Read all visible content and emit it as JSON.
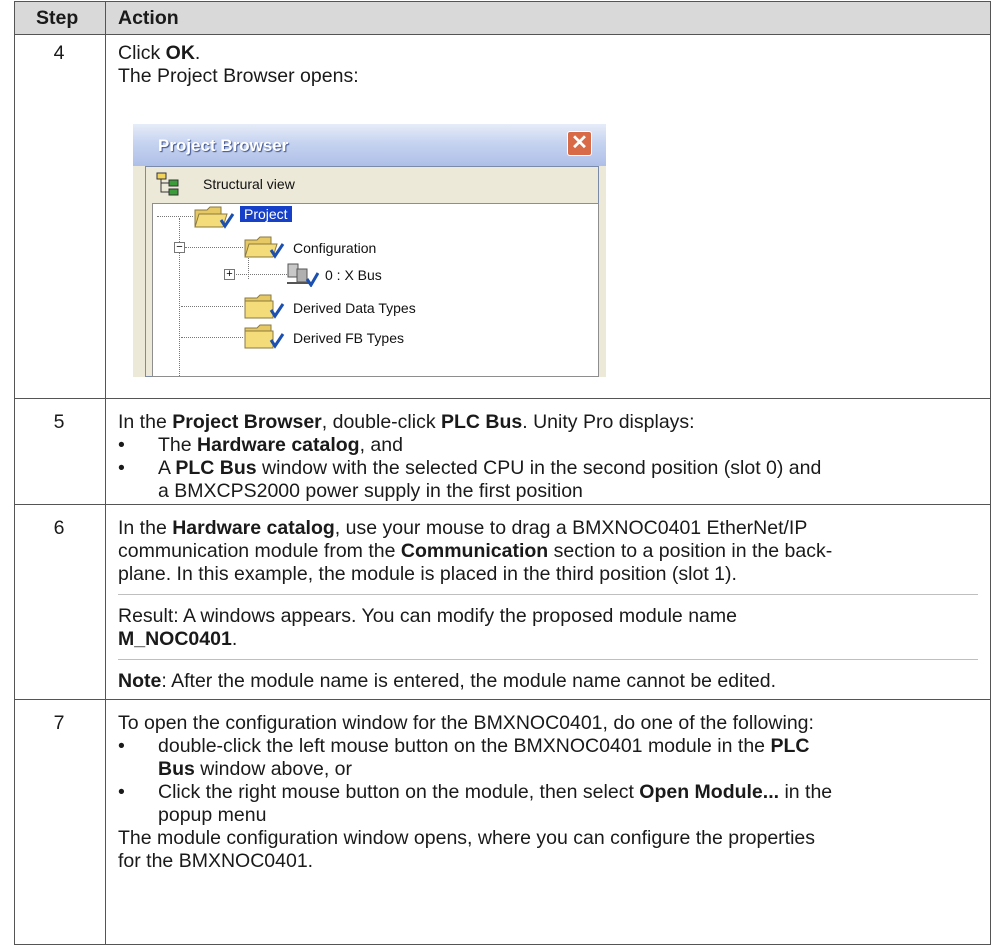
{
  "header": {
    "step": "Step",
    "action": "Action"
  },
  "rows": [
    {
      "step": "4",
      "line1_pre": "Click ",
      "line1_bold": "OK",
      "line1_post": ".",
      "line2": "The Project Browser opens:",
      "browser": {
        "title": "Project Browser",
        "close_glyph": "✕",
        "view_label": "Structural view",
        "nodes": [
          "Project",
          "Configuration",
          "0 : X Bus",
          "Derived Data Types",
          "Derived FB Types"
        ],
        "expanders": [
          "−",
          "+"
        ]
      }
    },
    {
      "step": "5",
      "p1": [
        "In the ",
        "Project Browser",
        ", double-click ",
        "PLC Bus",
        ". Unity Pro displays:"
      ],
      "b1": [
        "The ",
        "Hardware catalog",
        ", and"
      ],
      "b2": [
        "A ",
        "PLC Bus",
        " window with the selected CPU in the second position (slot 0) and"
      ],
      "b2_line2": "a BMXCPS2000 power supply in the first position",
      "bullet": "•"
    },
    {
      "step": "6",
      "p1": [
        "In the ",
        "Hardware catalog",
        ", use your mouse to drag a BMXNOC0401 EtherNet/IP"
      ],
      "p1b": [
        "communication module from the ",
        "Communication",
        " section to a position in the back-"
      ],
      "p1c": "plane. In this example, the module is placed in the third position (slot 1).",
      "p2": "Result: A windows appears. You can modify the proposed module name",
      "p2_bold": "M_NOC0401",
      "p2_post": ".",
      "p3": [
        "Note",
        ": After the module name is entered, the module name cannot be edited."
      ]
    },
    {
      "step": "7",
      "p1": "To open the configuration window  for the BMXNOC0401, do one of the following:",
      "b1": [
        "double-click the left mouse button on the BMXNOC0401 module in the ",
        "PLC"
      ],
      "b1_line2": [
        "Bus",
        " window above, or"
      ],
      "b2": [
        "Click the right mouse button on the module, then select ",
        "Open Module...",
        " in the"
      ],
      "b2_line2": "popup menu",
      "p2": "The module configuration window opens, where you can configure the properties",
      "p3": "for the BMXNOC0401.",
      "bullet": "•"
    }
  ]
}
